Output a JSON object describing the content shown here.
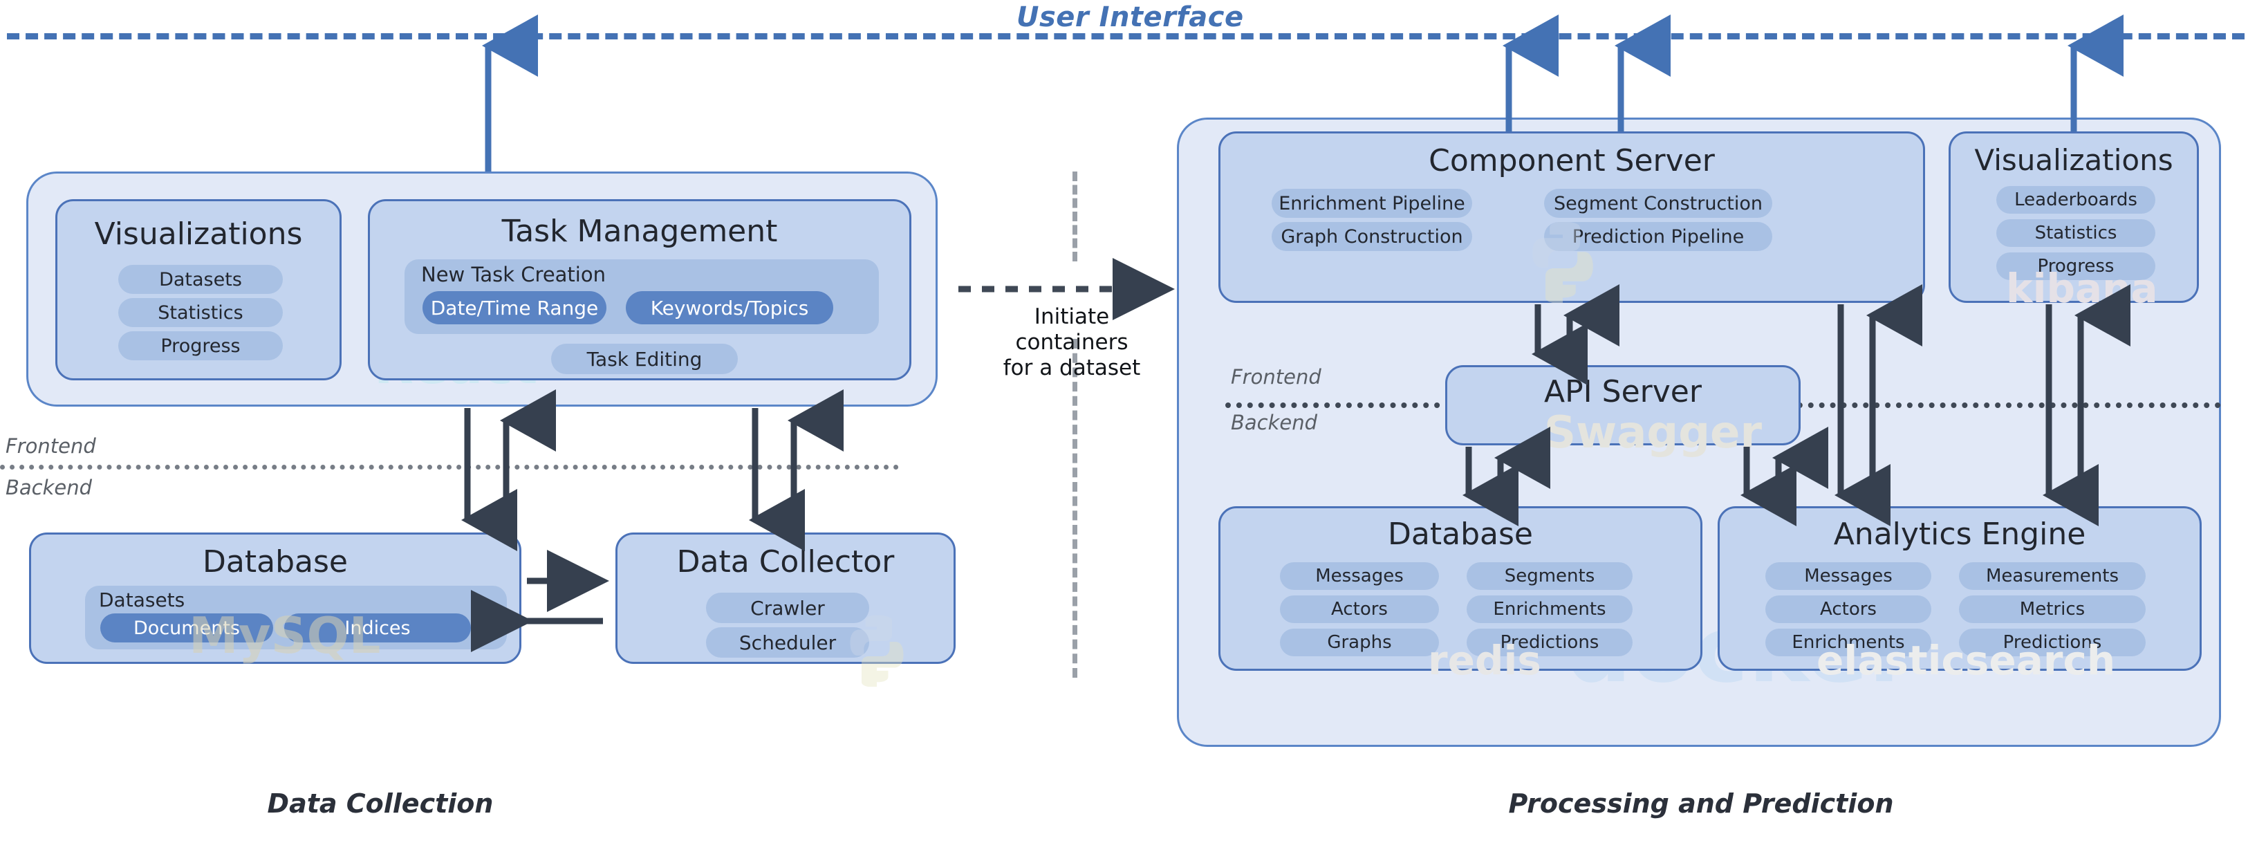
{
  "title": {
    "user_interface": "User Interface"
  },
  "sections": {
    "left_caption": "Data Collection",
    "right_caption": "Processing and Prediction"
  },
  "divider_labels": {
    "frontend": "Frontend",
    "backend": "Backend"
  },
  "middle": {
    "arrow_label": "Initiate\ncontainers\nfor a dataset",
    "arrow_label_line1": "Initiate",
    "arrow_label_line2": "containers",
    "arrow_label_line3": "for a dataset"
  },
  "left": {
    "visualizations": {
      "title": "Visualizations",
      "items": [
        "Datasets",
        "Statistics",
        "Progress"
      ]
    },
    "task_management": {
      "title": "Task Management",
      "new_task_creation": {
        "label": "New Task Creation",
        "options": [
          "Date/Time Range",
          "Keywords/Topics"
        ]
      },
      "task_editing": "Task Editing"
    },
    "database": {
      "title": "Database",
      "group_label": "Datasets",
      "items": [
        "Documents",
        "Indices"
      ]
    },
    "data_collector": {
      "title": "Data Collector",
      "items": [
        "Crawler",
        "Scheduler"
      ]
    }
  },
  "right": {
    "component_server": {
      "title": "Component Server",
      "items_left": [
        "Enrichment Pipeline",
        "Graph Construction"
      ],
      "items_right": [
        "Segment Construction",
        "Prediction Pipeline"
      ]
    },
    "visualizations": {
      "title": "Visualizations",
      "items": [
        "Leaderboards",
        "Statistics",
        "Progress"
      ]
    },
    "api_server": {
      "title": "API Server"
    },
    "database": {
      "title": "Database",
      "items_left": [
        "Messages",
        "Actors",
        "Graphs"
      ],
      "items_right": [
        "Segments",
        "Enrichments",
        "Predictions"
      ]
    },
    "analytics_engine": {
      "title": "Analytics Engine",
      "items_left": [
        "Messages",
        "Actors",
        "Enrichments"
      ],
      "items_right": [
        "Measurements",
        "Metrics",
        "Predictions"
      ]
    }
  },
  "watermarks": {
    "react": "React",
    "mysql": "MySQL",
    "swagger": "Swagger",
    "redis": "redis",
    "elasticsearch": "elasticsearch",
    "kibana": "kibana",
    "docker": "docker"
  },
  "colors": {
    "ui_accent": "#4472b4",
    "panel_fill": "#e2e9f7",
    "panel_border": "#5b86c8",
    "card_fill": "#c3d4ef",
    "card_border": "#4b72b8",
    "pill_fill": "#a9c1e4",
    "pill_dark_fill": "#5b84c4",
    "arrow_dark": "#36404f",
    "arrow_blue": "#4472b4",
    "divider_gray": "#777d86"
  }
}
